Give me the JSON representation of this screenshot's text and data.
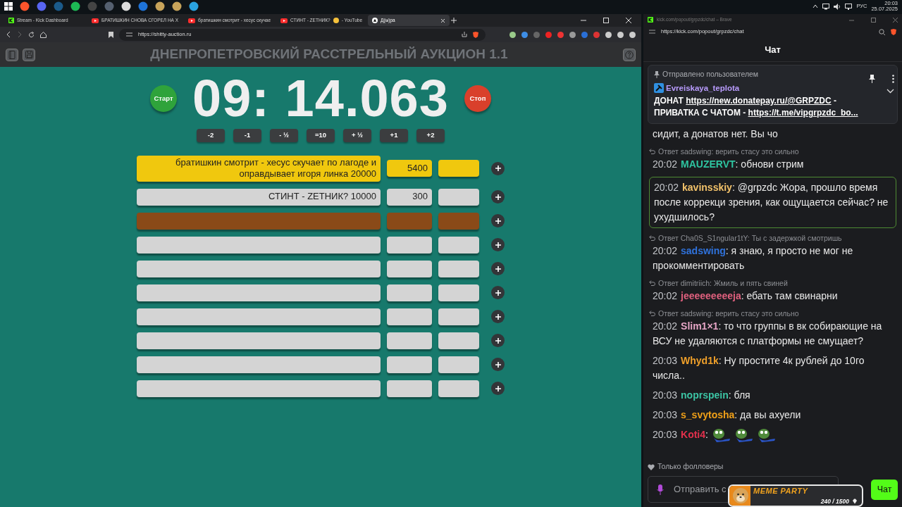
{
  "taskbar": {
    "language": "РУС",
    "time": "20:03",
    "date": "25.07.2025"
  },
  "browser": {
    "tabs": [
      {
        "label": "Stream - Kick Dashboard",
        "kind": "kick",
        "selected": false
      },
      {
        "label": "БРАТИШКИН СНОВА СГОРЕЛ НА Х",
        "kind": "youtube",
        "selected": false
      },
      {
        "label": "братишкин смотрит - хесус скучае",
        "kind": "youtube",
        "selected": false
      },
      {
        "label": "СТИНТ - ZETНИК?",
        "label_end": "- YouTube",
        "kind": "youtube",
        "selected": false
      },
      {
        "label": "Д(ы)ра",
        "kind": "site",
        "selected": true
      }
    ],
    "url": "https://shitty-auction.ru"
  },
  "auction": {
    "title": "ДНЕПРОПЕТРОВСКИЙ РАССТРЕЛЬНЫЙ АУКЦИОН 1.1",
    "start": "Старт",
    "timer": "09: 14.063",
    "stop": "Стоп",
    "adjust": [
      "-2",
      "-1",
      "- ½",
      "=10",
      "+ ½",
      "+1",
      "+2"
    ],
    "lots": [
      {
        "name": "братишкин смотрит - хесус скучает по лагоде и оправдывает игоря линка 20000",
        "amount": "5400",
        "color": "#f0c80e"
      },
      {
        "name": "СТИНТ - ZETНИК? 10000",
        "amount": "300",
        "color": "#d4d4d4"
      },
      {
        "color": "#8a4a18"
      },
      {
        "color": "#d4d4d4"
      },
      {
        "color": "#d4d4d4"
      },
      {
        "color": "#d4d4d4"
      },
      {
        "color": "#d4d4d4"
      },
      {
        "color": "#d4d4d4"
      },
      {
        "color": "#d4d4d4"
      },
      {
        "color": "#d4d4d4"
      }
    ]
  },
  "chat_window": {
    "title": "kick.com/popout/grpzdc/chat – Brave",
    "url": "https://kick.com/popout/grpzdc/chat",
    "header": "Чат",
    "pinned": {
      "label": "Отправлено пользователем",
      "user": "Evreiskaya_teplota",
      "parts": [
        {
          "kind": "text",
          "text": "ДОНАТ "
        },
        {
          "kind": "link",
          "text": "https://new.donatepay.ru/@GRPZDC"
        },
        {
          "kind": "text",
          "text": " - ПРИВАТКА С ЧАТОМ - "
        },
        {
          "kind": "link",
          "text": "https://t.me/vipgrpzdc_bo..."
        }
      ]
    },
    "messages": [
      {
        "text": "сидит, а донатов нет. Вы чо",
        "highlighted": false
      },
      {
        "reply": "Ответ sadswing: верить стасу это сильно",
        "time": "20:02",
        "user": "MAUZERVT",
        "color": "#2ec4a0",
        "text": ": обнови стрим",
        "highlighted": false
      },
      {
        "time": "20:02",
        "user": "kavinsskiy",
        "color": "#f2c26a",
        "text": ": @grpzdc Жора, прошло время после коррекци зрения, как ощущается сейчас? не ухудшилось?",
        "highlighted": true
      },
      {
        "reply": "Ответ Cha0S_S1ngular1tY: Ты с задержкой смотришь",
        "time": "20:02",
        "user": "sadswing",
        "color": "#2f72dc",
        "text": ": я знаю, я просто не мог не прокомментировать",
        "highlighted": false
      },
      {
        "reply": "Ответ dimitriich: Жмиль и пять свиней",
        "time": "20:02",
        "user": "jeeeeeeeeeja",
        "color": "#e0607e",
        "text": ": ебать там свинарни",
        "highlighted": false
      },
      {
        "reply": "Ответ sadswing: верить стасу это сильно",
        "time": "20:02",
        "user": "Slim1×1",
        "color": "#e6a6c6",
        "text": ": то что группы в вк собирающие на ВСУ не удаляются с платформы не смущает?",
        "highlighted": false
      },
      {
        "time": "20:03",
        "user": "Whyd1k",
        "color": "#f0a02a",
        "text": ": Ну простите 4к рублей до 10го числа..",
        "highlighted": false
      },
      {
        "time": "20:03",
        "user": "noprspein",
        "color": "#3cc4a4",
        "text": ": бля",
        "highlighted": false
      },
      {
        "time": "20:03",
        "user": "s_svytosha",
        "color": "#f0a018",
        "text": ": да вы ахуели",
        "highlighted": false
      },
      {
        "time": "20:03",
        "user": "Koti4",
        "color": "#e3304c",
        "text": ":",
        "emotes": [
          {
            "kind": "frog"
          },
          {
            "kind": "frog"
          },
          {
            "kind": "frog"
          }
        ],
        "highlighted": false
      }
    ],
    "followers_only": "Только фолловеры",
    "input": {
      "placeholder": "Отправить с"
    },
    "send": "Чат",
    "overlay": {
      "title": "MEME PARTY",
      "progress": "240 / 1500",
      "level": 0.16
    }
  }
}
